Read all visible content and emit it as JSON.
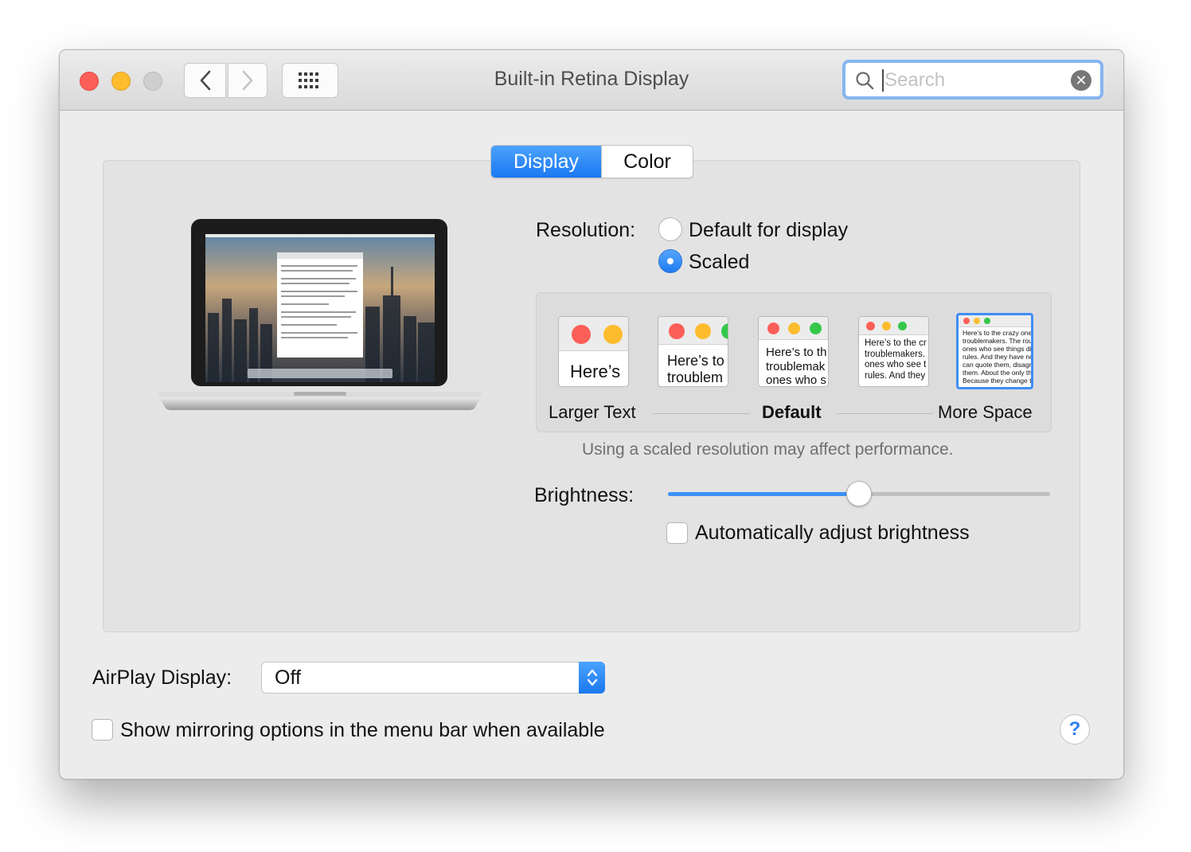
{
  "window": {
    "title": "Built-in Retina Display"
  },
  "toolbar": {
    "back_icon": "chevron-left-icon",
    "forward_icon": "chevron-right-icon",
    "show_all_icon": "grid-icon"
  },
  "search": {
    "placeholder": "Search",
    "value": ""
  },
  "tabs": [
    {
      "label": "Display",
      "active": true
    },
    {
      "label": "Color",
      "active": false
    }
  ],
  "resolution": {
    "label": "Resolution:",
    "options": [
      {
        "label": "Default for display",
        "selected": false
      },
      {
        "label": "Scaled",
        "selected": true
      }
    ],
    "scale_labels": {
      "left": "Larger Text",
      "middle": "Default",
      "right": "More Space"
    },
    "thumbnails": [
      {
        "text": "Here’s"
      },
      {
        "text": "Here’s to\ntroublem"
      },
      {
        "text": "Here’s to th\ntroublemak\nones who s"
      },
      {
        "text": "Here’s to the cr\ntroublemakers.\nones who see t\nrules. And they"
      },
      {
        "text": "Here’s to the crazy one\ntroublemakers. The rou\nones who see things di\nrules. And they have no\ncan quote them, disagr\nthem. About the only th\nBecause they change t"
      }
    ],
    "selected_thumbnail": 4,
    "performance_note": "Using a scaled resolution may affect performance."
  },
  "brightness": {
    "label": "Brightness:",
    "level": 0.5,
    "auto_label": "Automatically adjust brightness",
    "auto_checked": false
  },
  "airplay": {
    "label": "AirPlay Display:",
    "value": "Off"
  },
  "mirroring": {
    "label": "Show mirroring options in the menu bar when available",
    "checked": false
  },
  "help": {
    "label": "?"
  },
  "colors": {
    "accent": "#1b78f0",
    "close": "#fc5f57",
    "minimize": "#fdbc2e",
    "zoom_disabled": "#cfcfcf"
  }
}
